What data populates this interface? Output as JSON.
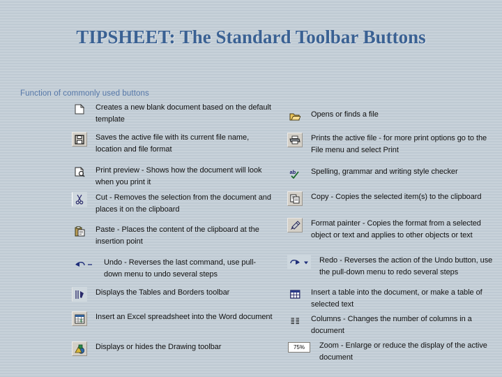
{
  "slide": {
    "title": "TIPSHEET: The Standard Toolbar Buttons",
    "subheading": "Function of commonly used buttons",
    "title_color": "#3a6193",
    "subheading_color": "#5577a8",
    "background_color": "#c6d0d8"
  },
  "left_column": [
    {
      "icon": "new-document-icon",
      "description": "Creates a new blank document based on the default template"
    },
    {
      "icon": "save-floppy-disk-icon",
      "description": "Saves the active file with its current file name, location and file format"
    },
    {
      "icon": "print-preview-icon",
      "description": "Print preview - Shows how the document will look when you print it"
    },
    {
      "icon": "cut-scissors-icon",
      "description": "Cut - Removes the selection from the document and places it on the clipboard"
    },
    {
      "icon": "paste-clipboard-icon",
      "description": "Paste - Places the content of the clipboard at the insertion point"
    },
    {
      "icon": "undo-arrow-dropdown-icon",
      "description": "Undo - Reverses the last command, use pull-down menu to undo several steps"
    },
    {
      "icon": "tables-and-borders-pencil-icon",
      "description": "Displays the Tables and Borders toolbar"
    },
    {
      "icon": "insert-excel-spreadsheet-icon",
      "description": "Insert an Excel spreadsheet into the Word document"
    },
    {
      "icon": "drawing-toolbar-icon",
      "description": "Displays or hides the Drawing toolbar"
    }
  ],
  "right_column": [
    {
      "icon": "open-folder-icon",
      "description": "Opens or finds a file"
    },
    {
      "icon": "print-printer-icon",
      "description": "Prints the active file - for more print options go to the File menu and select Print"
    },
    {
      "icon": "spelling-grammar-check-icon",
      "description": "Spelling, grammar and writing style checker"
    },
    {
      "icon": "copy-icon",
      "description": "Copy - Copies the selected item(s) to the clipboard"
    },
    {
      "icon": "format-painter-brush-icon",
      "description": "Format painter - Copies the format from a selected object or text and applies to other objects or text"
    },
    {
      "icon": "redo-arrow-dropdown-icon",
      "description": "Redo - Reverses the action of the Undo button, use the pull-down menu to redo several steps"
    },
    {
      "icon": "insert-table-grid-icon",
      "description": "Insert a table into the document, or make a table of selected text"
    },
    {
      "icon": "columns-icon",
      "description": "Columns - Changes the number of columns in a document"
    },
    {
      "icon": "zoom-percentage-box-icon",
      "description": "Zoom - Enlarge or reduce the display of the active document",
      "value": "75%"
    }
  ]
}
